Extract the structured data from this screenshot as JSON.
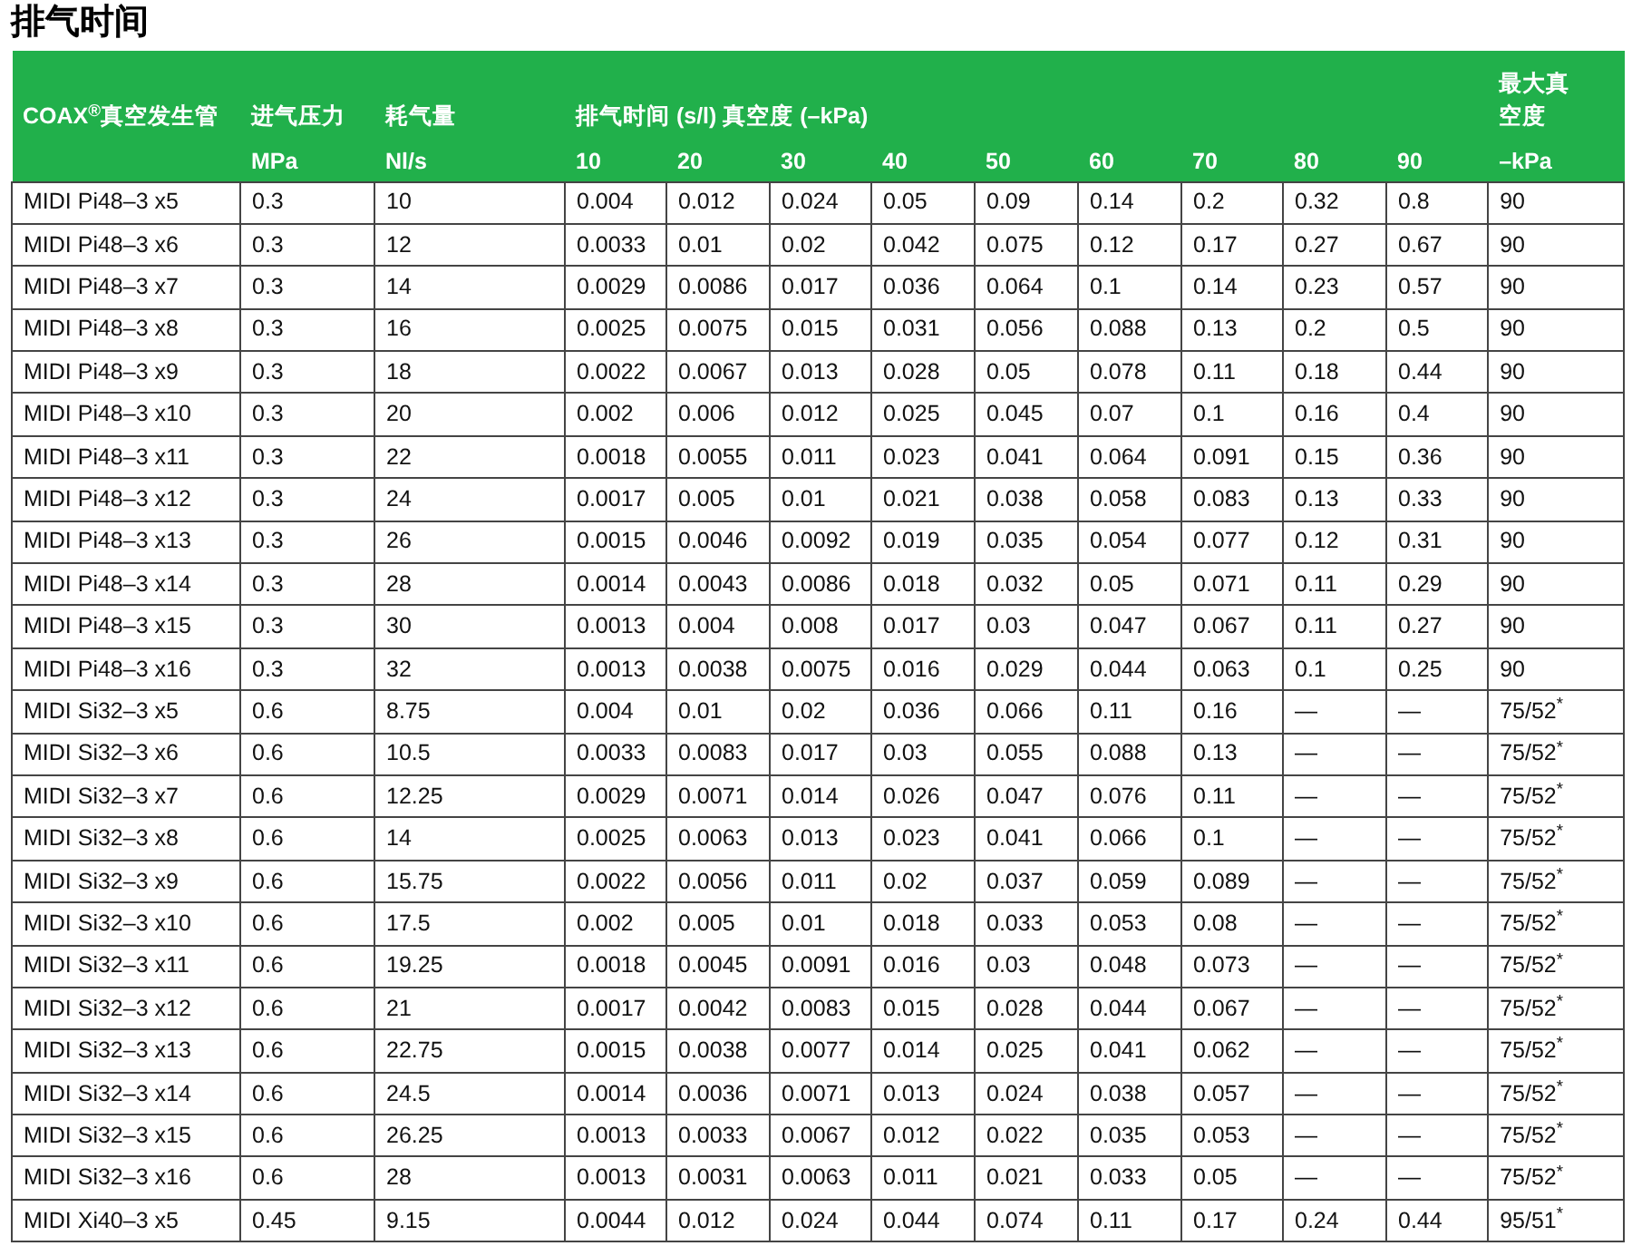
{
  "title": "排气时间",
  "header": {
    "product": "COAX$^{®}$真空发生管",
    "pressure": {
      "label": "进气压力",
      "unit": "MPa"
    },
    "flow": {
      "label": "耗气量",
      "unit": "Nl/s"
    },
    "evacuation": {
      "label": "排气时间 (s/l) 真空度 (–kPa)",
      "levels": [
        "10",
        "20",
        "30",
        "40",
        "50",
        "60",
        "70",
        "80",
        "90"
      ]
    },
    "max_vacuum": {
      "label": "最大真空度",
      "unit": "–kPa"
    }
  },
  "rows": [
    [
      "MIDI Pi48–3 x5",
      "0.3",
      "10",
      "0.004",
      "0.012",
      "0.024",
      "0.05",
      "0.09",
      "0.14",
      "0.2",
      "0.32",
      "0.8",
      "90"
    ],
    [
      "MIDI Pi48–3 x6",
      "0.3",
      "12",
      "0.0033",
      "0.01",
      "0.02",
      "0.042",
      "0.075",
      "0.12",
      "0.17",
      "0.27",
      "0.67",
      "90"
    ],
    [
      "MIDI Pi48–3 x7",
      "0.3",
      "14",
      "0.0029",
      "0.0086",
      "0.017",
      "0.036",
      "0.064",
      "0.1",
      "0.14",
      "0.23",
      "0.57",
      "90"
    ],
    [
      "MIDI Pi48–3 x8",
      "0.3",
      "16",
      "0.0025",
      "0.0075",
      "0.015",
      "0.031",
      "0.056",
      "0.088",
      "0.13",
      "0.2",
      "0.5",
      "90"
    ],
    [
      "MIDI Pi48–3 x9",
      "0.3",
      "18",
      "0.0022",
      "0.0067",
      "0.013",
      "0.028",
      "0.05",
      "0.078",
      "0.11",
      "0.18",
      "0.44",
      "90"
    ],
    [
      "MIDI Pi48–3 x10",
      "0.3",
      "20",
      "0.002",
      "0.006",
      "0.012",
      "0.025",
      "0.045",
      "0.07",
      "0.1",
      "0.16",
      "0.4",
      "90"
    ],
    [
      "MIDI Pi48–3 x11",
      "0.3",
      "22",
      "0.0018",
      "0.0055",
      "0.011",
      "0.023",
      "0.041",
      "0.064",
      "0.091",
      "0.15",
      "0.36",
      "90"
    ],
    [
      "MIDI Pi48–3 x12",
      "0.3",
      "24",
      "0.0017",
      "0.005",
      "0.01",
      "0.021",
      "0.038",
      "0.058",
      "0.083",
      "0.13",
      "0.33",
      "90"
    ],
    [
      "MIDI Pi48–3 x13",
      "0.3",
      "26",
      "0.0015",
      "0.0046",
      "0.0092",
      "0.019",
      "0.035",
      "0.054",
      "0.077",
      "0.12",
      "0.31",
      "90"
    ],
    [
      "MIDI Pi48–3 x14",
      "0.3",
      "28",
      "0.0014",
      "0.0043",
      "0.0086",
      "0.018",
      "0.032",
      "0.05",
      "0.071",
      "0.11",
      "0.29",
      "90"
    ],
    [
      "MIDI Pi48–3 x15",
      "0.3",
      "30",
      "0.0013",
      "0.004",
      "0.008",
      "0.017",
      "0.03",
      "0.047",
      "0.067",
      "0.11",
      "0.27",
      "90"
    ],
    [
      "MIDI Pi48–3 x16",
      "0.3",
      "32",
      "0.0013",
      "0.0038",
      "0.0075",
      "0.016",
      "0.029",
      "0.044",
      "0.063",
      "0.1",
      "0.25",
      "90"
    ],
    [
      "MIDI Si32–3 x5",
      "0.6",
      "8.75",
      "0.004",
      "0.01",
      "0.02",
      "0.036",
      "0.066",
      "0.11",
      "0.16",
      "—",
      "—",
      "75/52$^{*}$"
    ],
    [
      "MIDI Si32–3 x6",
      "0.6",
      "10.5",
      "0.0033",
      "0.0083",
      "0.017",
      "0.03",
      "0.055",
      "0.088",
      "0.13",
      "—",
      "—",
      "75/52$^{*}$"
    ],
    [
      "MIDI Si32–3 x7",
      "0.6",
      "12.25",
      "0.0029",
      "0.0071",
      "0.014",
      "0.026",
      "0.047",
      "0.076",
      "0.11",
      "—",
      "—",
      "75/52$^{*}$"
    ],
    [
      "MIDI Si32–3 x8",
      "0.6",
      "14",
      "0.0025",
      "0.0063",
      "0.013",
      "0.023",
      "0.041",
      "0.066",
      "0.1",
      "—",
      "—",
      "75/52$^{*}$"
    ],
    [
      "MIDI Si32–3 x9",
      "0.6",
      "15.75",
      "0.0022",
      "0.0056",
      "0.011",
      "0.02",
      "0.037",
      "0.059",
      "0.089",
      "—",
      "—",
      "75/52$^{*}$"
    ],
    [
      "MIDI Si32–3 x10",
      "0.6",
      "17.5",
      "0.002",
      "0.005",
      "0.01",
      "0.018",
      "0.033",
      "0.053",
      "0.08",
      "—",
      "—",
      "75/52$^{*}$"
    ],
    [
      "MIDI Si32–3 x11",
      "0.6",
      "19.25",
      "0.0018",
      "0.0045",
      "0.0091",
      "0.016",
      "0.03",
      "0.048",
      "0.073",
      "—",
      "—",
      "75/52$^{*}$"
    ],
    [
      "MIDI Si32–3 x12",
      "0.6",
      "21",
      "0.0017",
      "0.0042",
      "0.0083",
      "0.015",
      "0.028",
      "0.044",
      "0.067",
      "—",
      "—",
      "75/52$^{*}$"
    ],
    [
      "MIDI Si32–3 x13",
      "0.6",
      "22.75",
      "0.0015",
      "0.0038",
      "0.0077",
      "0.014",
      "0.025",
      "0.041",
      "0.062",
      "—",
      "—",
      "75/52$^{*}$"
    ],
    [
      "MIDI Si32–3 x14",
      "0.6",
      "24.5",
      "0.0014",
      "0.0036",
      "0.0071",
      "0.013",
      "0.024",
      "0.038",
      "0.057",
      "—",
      "—",
      "75/52$^{*}$"
    ],
    [
      "MIDI Si32–3 x15",
      "0.6",
      "26.25",
      "0.0013",
      "0.0033",
      "0.0067",
      "0.012",
      "0.022",
      "0.035",
      "0.053",
      "—",
      "—",
      "75/52$^{*}$"
    ],
    [
      "MIDI Si32–3 x16",
      "0.6",
      "28",
      "0.0013",
      "0.0031",
      "0.0063",
      "0.011",
      "0.021",
      "0.033",
      "0.05",
      "—",
      "—",
      "75/52$^{*}$"
    ],
    [
      "MIDI Xi40–3 x5",
      "0.45",
      "9.15",
      "0.0044",
      "0.012",
      "0.024",
      "0.044",
      "0.074",
      "0.11",
      "0.17",
      "0.24",
      "0.44",
      "95/51$^{*}$"
    ]
  ]
}
